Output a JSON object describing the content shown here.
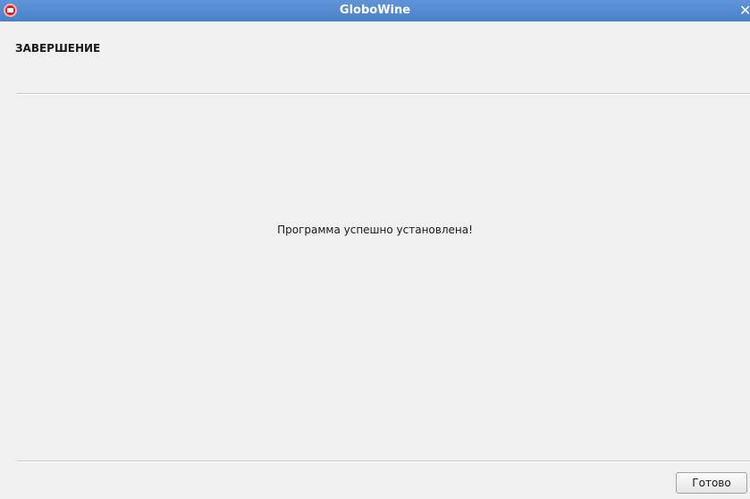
{
  "window": {
    "title": "GloboWine",
    "close_glyph": "✕",
    "icon": "app-logo-icon",
    "accent_color": "#4a80c6"
  },
  "page": {
    "header_title": "ЗАВЕРШЕНИЕ",
    "message": "Программа успешно установлена!"
  },
  "footer": {
    "finish_label": "Готово"
  }
}
